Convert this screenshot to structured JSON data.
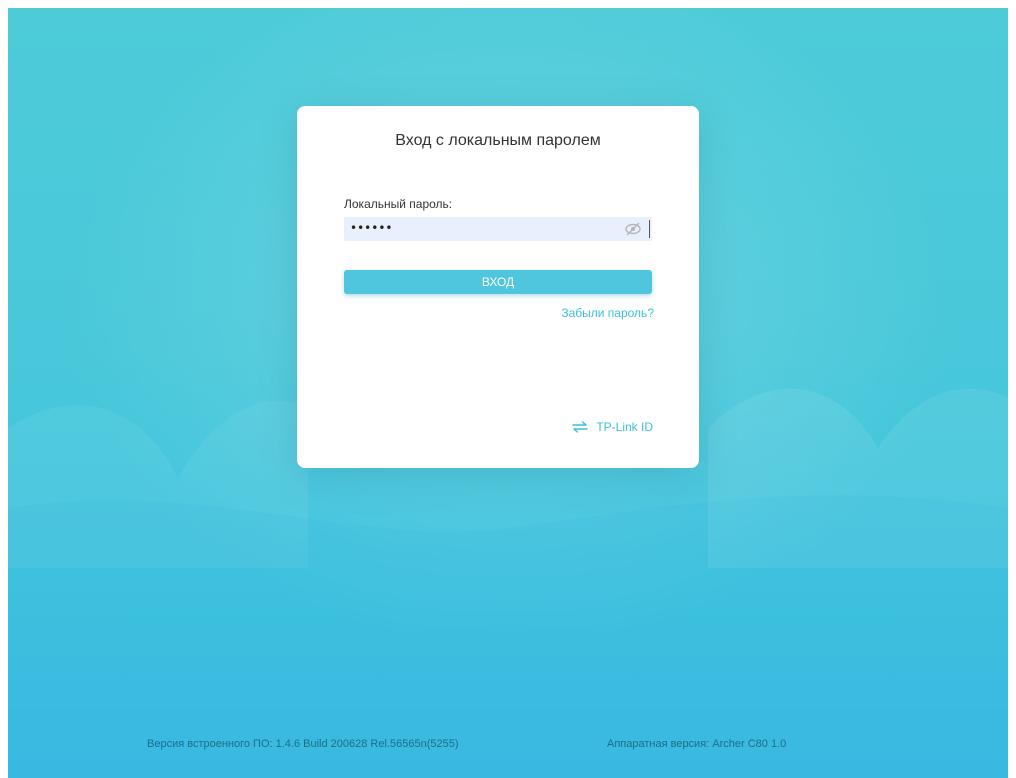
{
  "login": {
    "title": "Вход с локальным паролем",
    "password_label": "Локальный пароль:",
    "password_value": "••••••",
    "login_button": "ВХОД",
    "forgot_link": "Забыли пароль?",
    "tplink_id_link": "TP-Link ID"
  },
  "footer": {
    "firmware_version": "Версия встроенного ПО: 1.4.6 Build 200628 Rel.56565n(5255)",
    "hardware_version": "Аппаратная версия: Archer C80 1.0"
  },
  "icons": {
    "password_toggle": "eye-slash-icon",
    "switch_account": "swap-arrows-icon"
  },
  "colors": {
    "background_top": "#4dcbd9",
    "background_bottom": "#3ab9e3",
    "accent": "#3ac0d8",
    "button": "#4fc6dd",
    "input_bg": "#e8f0fe"
  }
}
